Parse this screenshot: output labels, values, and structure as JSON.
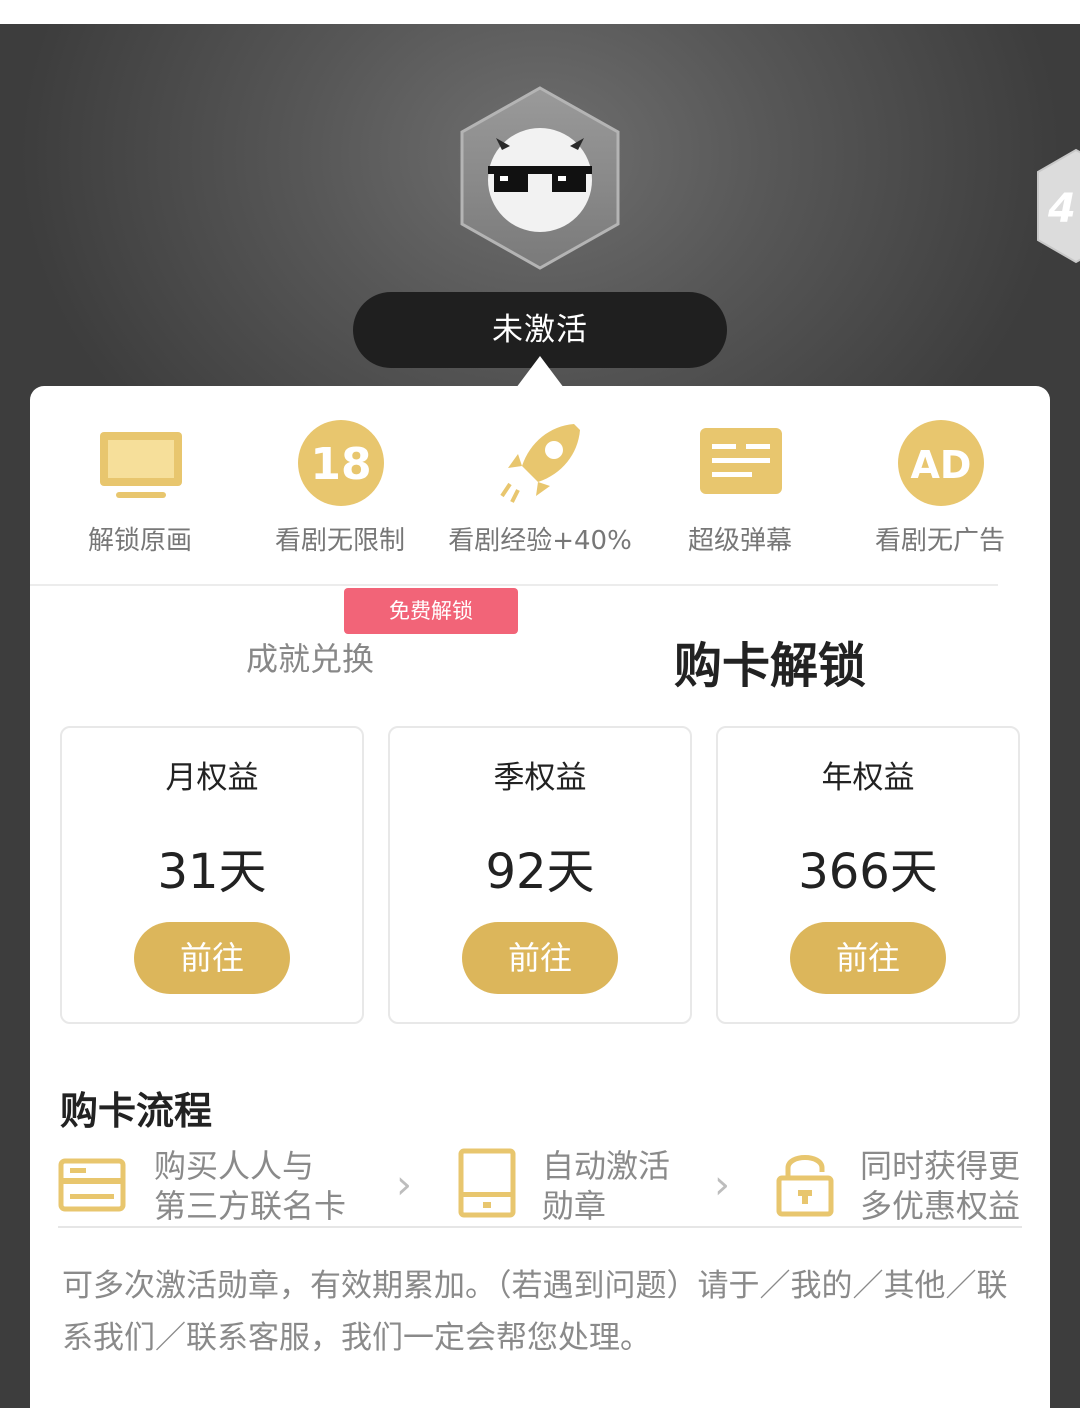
{
  "header": {
    "status_label": "未激活",
    "side_badge_number": "4"
  },
  "perks": [
    {
      "label": "解锁原画",
      "icon": "monitor-icon"
    },
    {
      "label": "看剧无限制",
      "icon": "18-badge-icon"
    },
    {
      "label": "看剧经验+40%",
      "icon": "rocket-icon"
    },
    {
      "label": "超级弹幕",
      "icon": "danmaku-icon"
    },
    {
      "label": "看剧无广告",
      "icon": "ad-free-icon"
    }
  ],
  "tabs": {
    "free_tag": "免费解锁",
    "redeem": "成就兑换",
    "buy": "购卡解锁"
  },
  "plans": [
    {
      "name": "月权益",
      "days": "31天",
      "button": "前往"
    },
    {
      "name": "季权益",
      "days": "92天",
      "button": "前往"
    },
    {
      "name": "年权益",
      "days": "366天",
      "button": "前往"
    }
  ],
  "flow": {
    "title": "购卡流程",
    "steps": [
      {
        "line1": "购买人人与",
        "line2": "第三方联名卡",
        "icon": "card-icon"
      },
      {
        "line1": "自动激活",
        "line2": "勋章",
        "icon": "device-icon"
      },
      {
        "line1": "同时获得更",
        "line2": "多优惠权益",
        "icon": "lock-icon"
      }
    ],
    "chevron": "›"
  },
  "note": "可多次激活勋章，有效期累加。（若遇到问题）请于／我的／其他／联系我们／联系客服，我们一定会帮您处理。",
  "colors": {
    "gold": "#dcb65b",
    "pink_tag": "#f26478",
    "dark_pill": "#1f1f1f"
  }
}
